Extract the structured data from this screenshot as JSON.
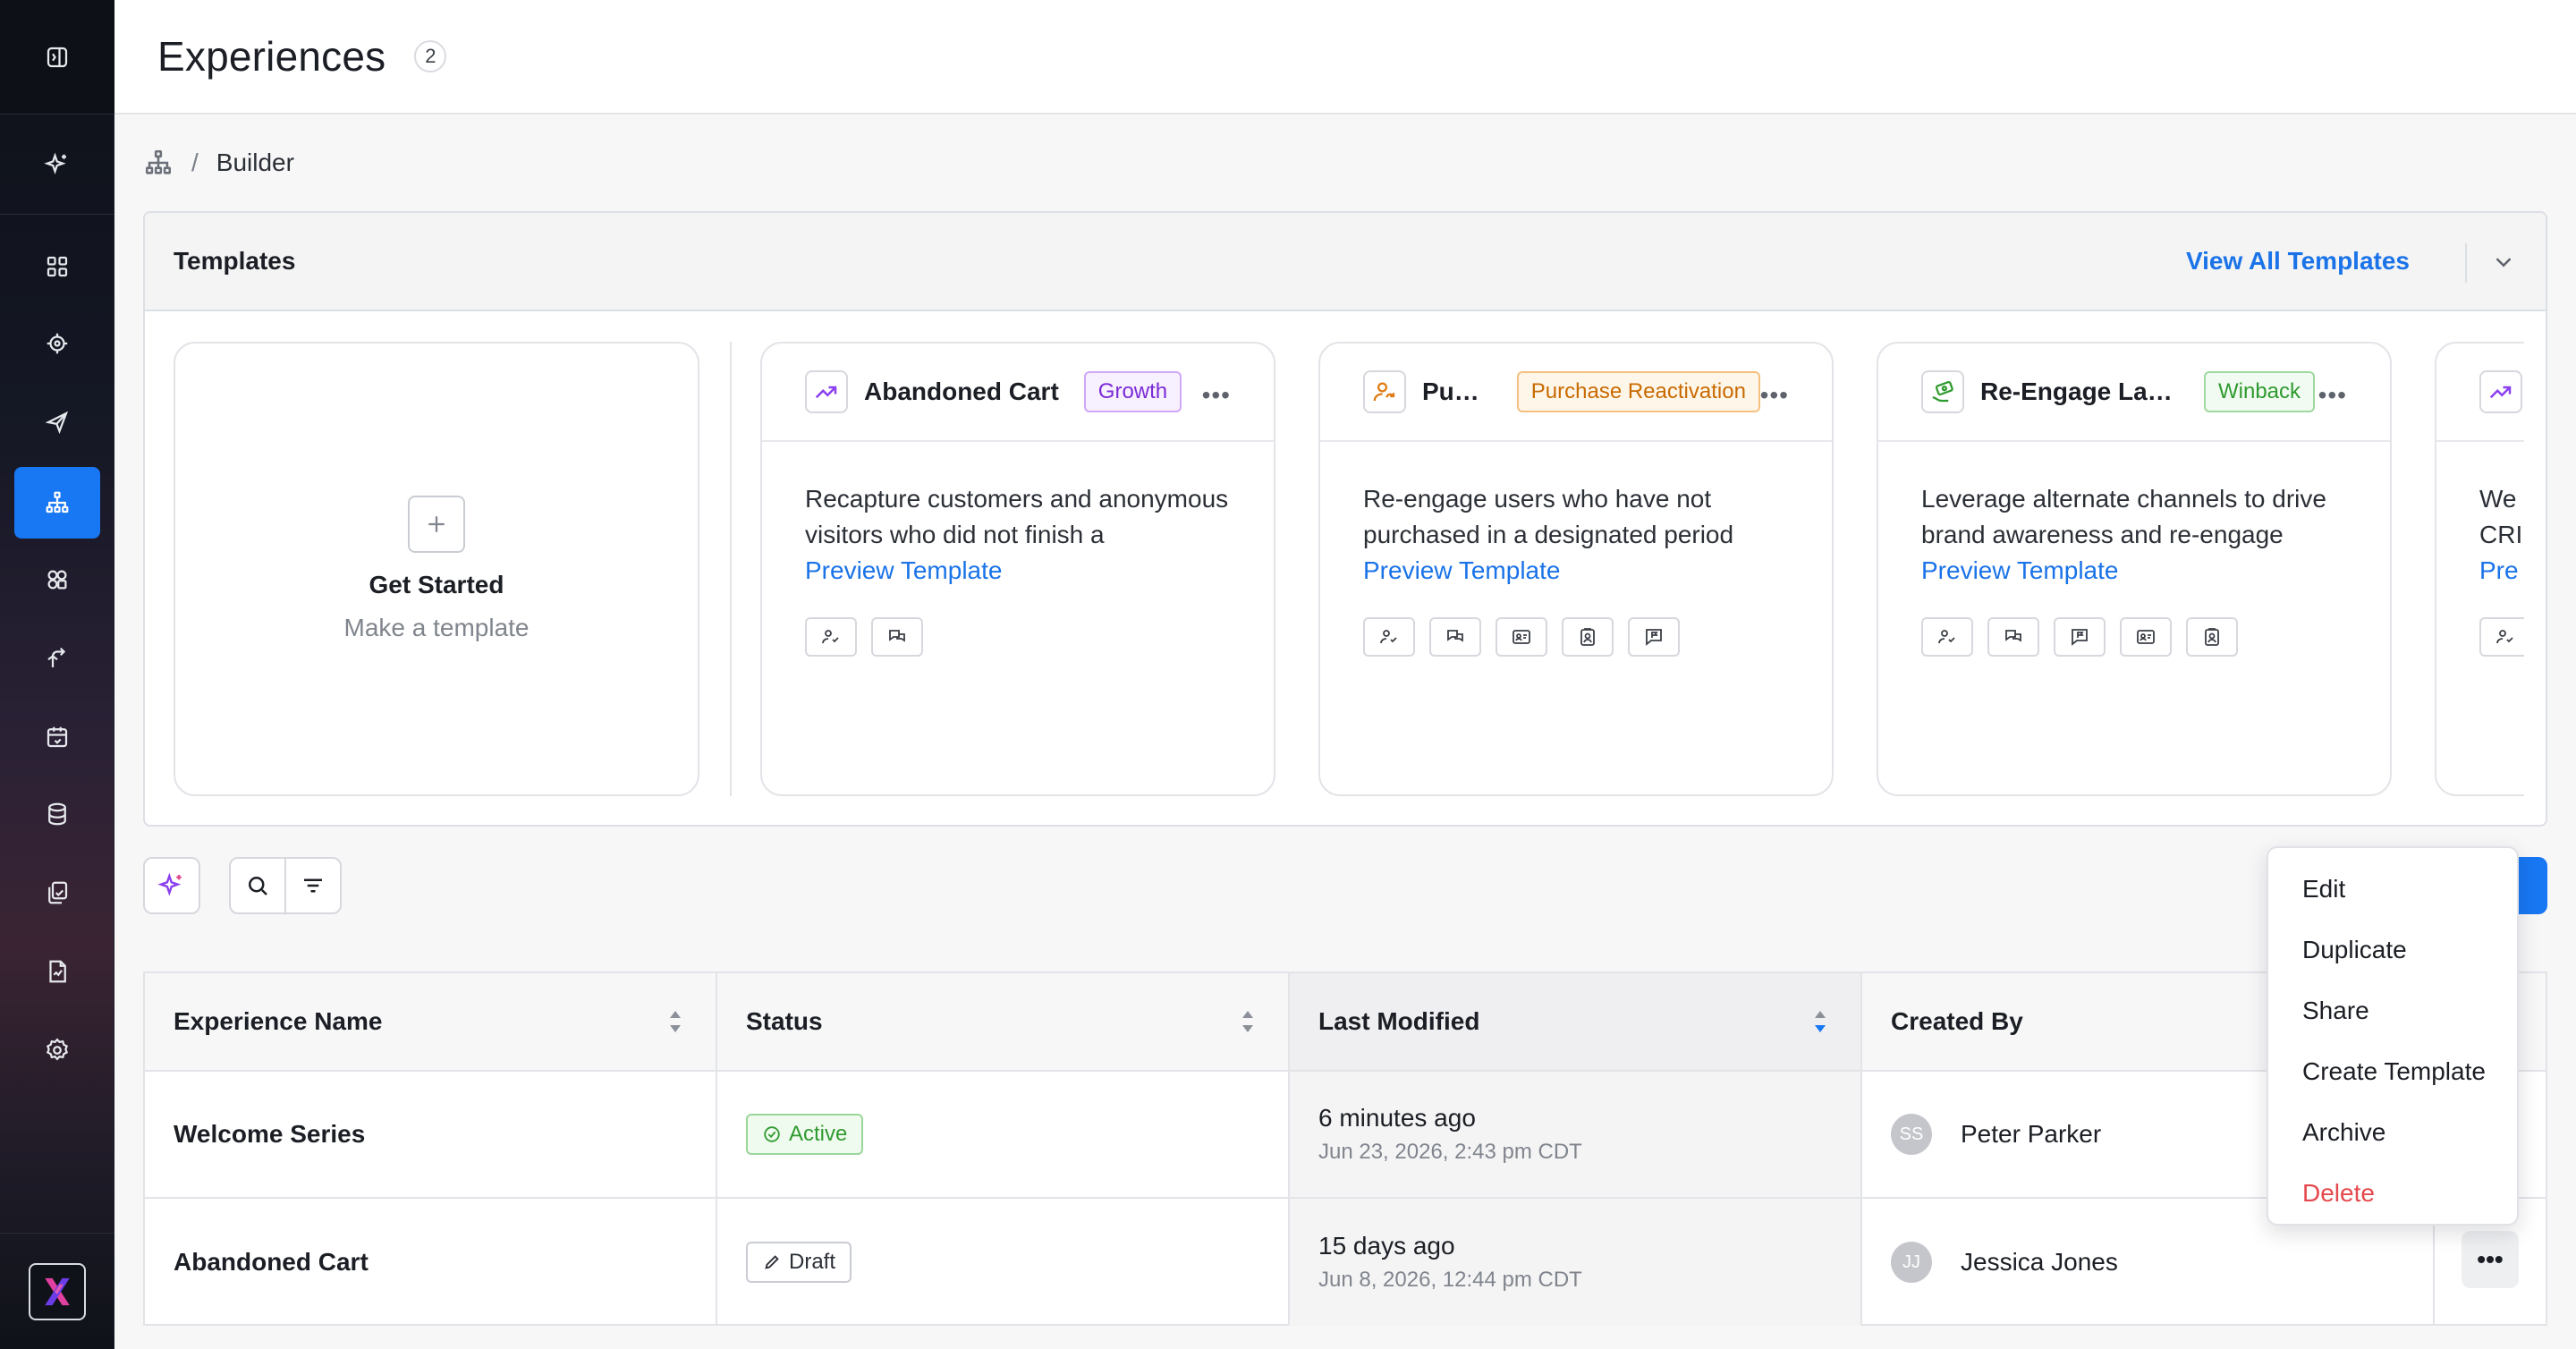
{
  "header": {
    "title": "Experiences",
    "count": "2"
  },
  "breadcrumb": {
    "current": "Builder",
    "separator": "/"
  },
  "sidebar": {
    "items": [
      {
        "icon": "sidebar-toggle-icon"
      },
      {
        "icon": "sparkle-icon"
      },
      {
        "icon": "dashboard-icon"
      },
      {
        "icon": "target-icon"
      },
      {
        "icon": "send-icon"
      },
      {
        "icon": "hierarchy-icon",
        "active": true
      },
      {
        "icon": "segments-icon"
      },
      {
        "icon": "journey-icon"
      },
      {
        "icon": "calendar-icon"
      },
      {
        "icon": "database-icon"
      },
      {
        "icon": "library-icon"
      },
      {
        "icon": "report-icon"
      },
      {
        "icon": "settings-icon"
      }
    ],
    "accent": "#1877f2"
  },
  "templates": {
    "title": "Templates",
    "view_all": "View All Templates",
    "get_started": {
      "title": "Get Started",
      "subtitle": "Make a template"
    },
    "cards": [
      {
        "title": "Abandoned Cart",
        "tag": "Growth",
        "description": "Recapture customers and anonymous visitors who did not finish a purchase…",
        "preview": "Preview Template",
        "channels": [
          "audience-icon",
          "chat-icon"
        ]
      },
      {
        "title": "Pu…",
        "tag": "Purchase Reactivation",
        "description": "Re-engage users who have not purchased in a designated period wit…",
        "preview": "Preview Template",
        "channels": [
          "audience-icon",
          "chat-icon",
          "id-card-icon",
          "contact-icon",
          "message-flag-icon"
        ]
      },
      {
        "title": "Re-Engage Lap…",
        "tag": "Winback",
        "description": "Leverage alternate channels to drive brand awareness and re-engage user…",
        "preview": "Preview Template",
        "channels": [
          "audience-icon",
          "chat-icon",
          "message-flag-icon",
          "id-card-icon",
          "contact-icon"
        ]
      },
      {
        "desc_partial_1": "We",
        "desc_partial_2": "CRI",
        "preview_partial": "Pre"
      }
    ]
  },
  "table": {
    "columns": [
      "Experience Name",
      "Status",
      "Last Modified",
      "Created By"
    ],
    "rows": [
      {
        "name": "Welcome Series",
        "status": "Active",
        "modified_relative": "6 minutes ago",
        "modified_absolute": "Jun 23, 2026, 2:43 pm CDT",
        "creator_initials": "SS",
        "creator": "Peter Parker"
      },
      {
        "name": "Abandoned Cart",
        "status": "Draft",
        "modified_relative": "15 days ago",
        "modified_absolute": "Jun 8, 2026, 12:44 pm CDT",
        "creator_initials": "JJ",
        "creator": "Jessica Jones"
      }
    ],
    "more_label": "•••"
  },
  "menu": {
    "items": [
      "Edit",
      "Duplicate",
      "Share",
      "Create Template",
      "Archive",
      "Delete"
    ]
  }
}
